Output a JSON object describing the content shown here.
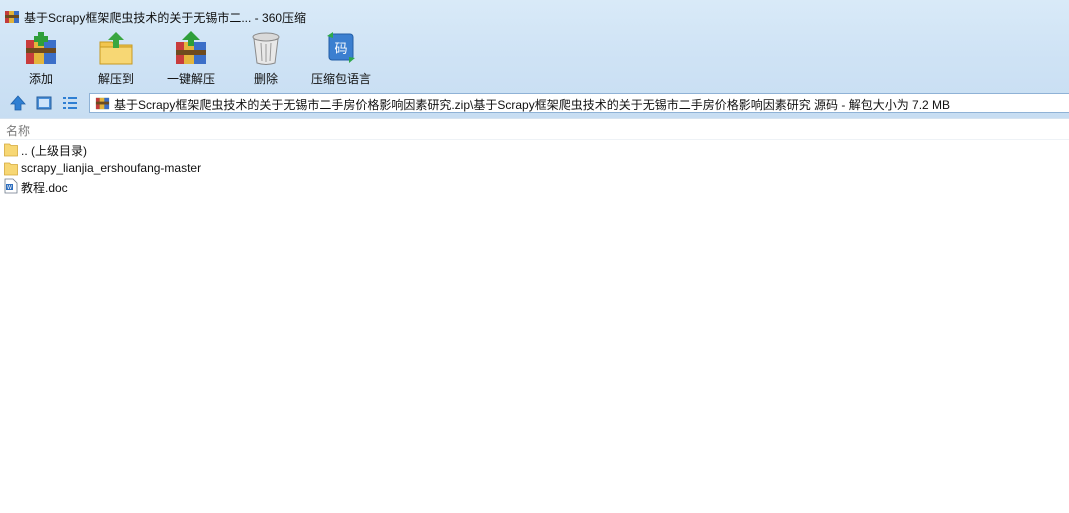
{
  "window": {
    "title": "基于Scrapy框架爬虫技术的关于无锡市二... - 360压缩"
  },
  "toolbar": {
    "buttons": [
      {
        "label": "添加",
        "icon": "add-archive-icon"
      },
      {
        "label": "解压到",
        "icon": "extract-to-icon"
      },
      {
        "label": "一键解压",
        "icon": "one-click-extract-icon"
      },
      {
        "label": "删除",
        "icon": "delete-trash-icon"
      },
      {
        "label": "压缩包语言",
        "icon": "archive-language-icon"
      }
    ],
    "language_icon_glyph": "码"
  },
  "nav": {
    "address_path": "基于Scrapy框架爬虫技术的关于无锡市二手房价格影响因素研究.zip\\基于Scrapy框架爬虫技术的关于无锡市二手房价格影响因素研究 源码 - 解包大小为 7.2 MB"
  },
  "list": {
    "column_header": "名称",
    "items": [
      {
        "name": ".. (上级目录)",
        "type": "parent-folder"
      },
      {
        "name": "scrapy_lianjia_ershoufang-master",
        "type": "folder"
      },
      {
        "name": "教程.doc",
        "type": "doc"
      }
    ]
  },
  "colors": {
    "chrome_bg": "#cfe3f5",
    "folder_yellow": "#f7d774",
    "accent_blue": "#2f7fd3"
  }
}
